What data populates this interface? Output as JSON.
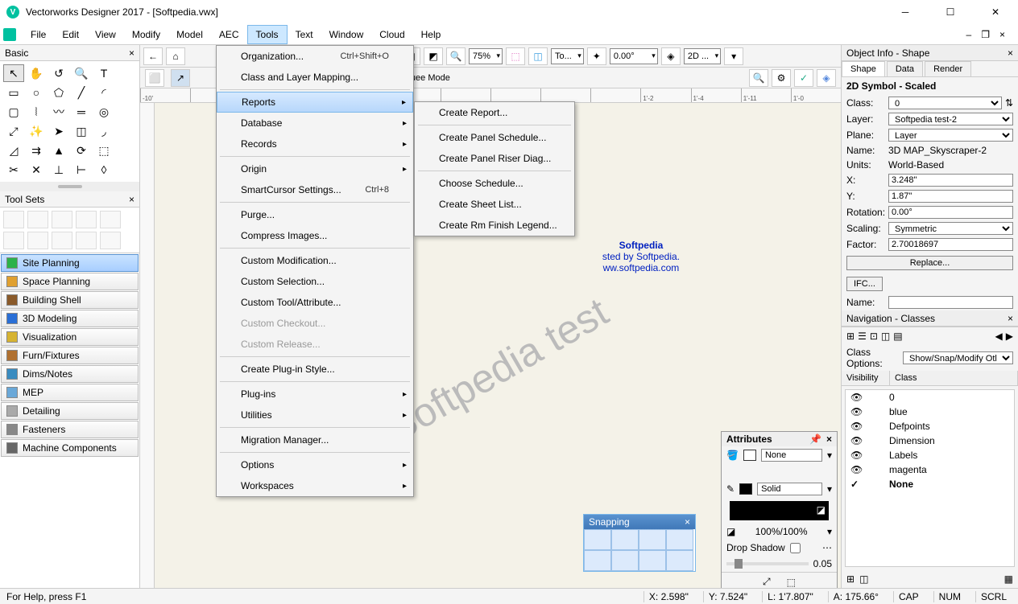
{
  "titlebar": {
    "title": "Vectorworks Designer 2017 - [Softpedia.vwx]"
  },
  "menubar": [
    "File",
    "Edit",
    "View",
    "Modify",
    "Model",
    "AEC",
    "Tools",
    "Text",
    "Window",
    "Cloud",
    "Help"
  ],
  "tools_menu": [
    {
      "label": "Organization...",
      "shortcut": "Ctrl+Shift+O"
    },
    {
      "label": "Class and Layer Mapping..."
    },
    {
      "sep": true
    },
    {
      "label": "Reports",
      "sub": true,
      "highlight": true
    },
    {
      "label": "Database",
      "sub": true
    },
    {
      "label": "Records",
      "sub": true
    },
    {
      "sep": true
    },
    {
      "label": "Origin",
      "sub": true
    },
    {
      "label": "SmartCursor Settings...",
      "shortcut": "Ctrl+8"
    },
    {
      "sep": true
    },
    {
      "label": "Purge..."
    },
    {
      "label": "Compress Images..."
    },
    {
      "sep": true
    },
    {
      "label": "Custom Modification..."
    },
    {
      "label": "Custom Selection..."
    },
    {
      "label": "Custom Tool/Attribute..."
    },
    {
      "label": "Custom Checkout...",
      "disabled": true
    },
    {
      "label": "Custom Release...",
      "disabled": true
    },
    {
      "sep": true
    },
    {
      "label": "Create Plug-in Style..."
    },
    {
      "sep": true
    },
    {
      "label": "Plug-ins",
      "sub": true
    },
    {
      "label": "Utilities",
      "sub": true
    },
    {
      "sep": true
    },
    {
      "label": "Migration Manager..."
    },
    {
      "sep": true
    },
    {
      "label": "Options",
      "sub": true
    },
    {
      "label": "Workspaces",
      "sub": true
    }
  ],
  "reports_submenu": [
    {
      "label": "Create Report..."
    },
    {
      "sep": true
    },
    {
      "label": "Create Panel Schedule..."
    },
    {
      "label": "Create Panel Riser Diag..."
    },
    {
      "sep": true
    },
    {
      "label": "Choose Schedule..."
    },
    {
      "label": "Create Sheet List..."
    },
    {
      "label": "Create Rm Finish Legend..."
    }
  ],
  "basic_palette": {
    "title": "Basic"
  },
  "toolsets": {
    "title": "Tool Sets",
    "list": [
      {
        "label": "Site Planning",
        "color": "#2bb24a",
        "active": true
      },
      {
        "label": "Space Planning",
        "color": "#e0a030"
      },
      {
        "label": "Building Shell",
        "color": "#8a5a2a"
      },
      {
        "label": "3D Modeling",
        "color": "#2a6fd6"
      },
      {
        "label": "Visualization",
        "color": "#d6b332"
      },
      {
        "label": "Furn/Fixtures",
        "color": "#b07030"
      },
      {
        "label": "Dims/Notes",
        "color": "#3a8cc0"
      },
      {
        "label": "MEP",
        "color": "#6aa8d8"
      },
      {
        "label": "Detailing",
        "color": "#aaaaaa"
      },
      {
        "label": "Fasteners",
        "color": "#888888"
      },
      {
        "label": "Machine Components",
        "color": "#666666"
      }
    ]
  },
  "mode_bar": {
    "text": "ection Tool: Rectangular Marquee Mode"
  },
  "toolbar": {
    "zoom": "75%",
    "angle": "0.00°",
    "layer": "To...",
    "view": "2D ..."
  },
  "ruler_h_ticks": [
    "-10'",
    "",
    "",
    "",
    "",
    "",
    "",
    "",
    "",
    "",
    "1'-2",
    "1'-4",
    "1'-11",
    "1'-0"
  ],
  "snapping": {
    "title": "Snapping"
  },
  "attributes": {
    "title": "Attributes",
    "fill_style": "None",
    "line_style": "Solid",
    "opacity": "100%/100%",
    "drop_shadow": "Drop Shadow",
    "shadow_val": "0.05"
  },
  "object_info": {
    "title": "Object Info - Shape",
    "tabs": [
      "Shape",
      "Data",
      "Render"
    ],
    "heading": "2D Symbol - Scaled",
    "class_val": "0",
    "layer_val": "Softpedia test-2",
    "plane_val": "Layer",
    "name_lbl": "Name:",
    "name_val": "3D MAP_Skyscraper-2",
    "units_lbl": "Units:",
    "units_val": "World-Based",
    "x_lbl": "X:",
    "x_val": "3.248\"",
    "y_lbl": "Y:",
    "y_val": "1.87\"",
    "rot_lbl": "Rotation:",
    "rot_val": "0.00°",
    "scaling_lbl": "Scaling:",
    "scaling_val": "Symmetric",
    "factor_lbl": "Factor:",
    "factor_val": "2.70018697",
    "replace_btn": "Replace..."
  },
  "ifc": {
    "btn": "IFC...",
    "name_lbl": "Name:",
    "name_val": ""
  },
  "navigation": {
    "title": "Navigation - Classes",
    "options_lbl": "Class Options:",
    "options_val": "Show/Snap/Modify Otl",
    "cols": [
      "Visibility",
      "Class"
    ],
    "rows": [
      "0",
      "blue",
      "Defpoints",
      "Dimension",
      "Labels",
      "magenta",
      "None"
    ]
  },
  "softpedia": {
    "l1": "Softpedia",
    "l2": "sted by Softpedia.",
    "l3": "ww.softpedia.com"
  },
  "watermark": "Softpedia test",
  "statusbar": {
    "help": "For Help, press F1",
    "x": "X: 2.598\"",
    "y": "Y: 7.524\"",
    "l": "L: 1'7.807\"",
    "a": "A: 175.66°",
    "cap": "CAP",
    "num": "NUM",
    "scrl": "SCRL"
  }
}
